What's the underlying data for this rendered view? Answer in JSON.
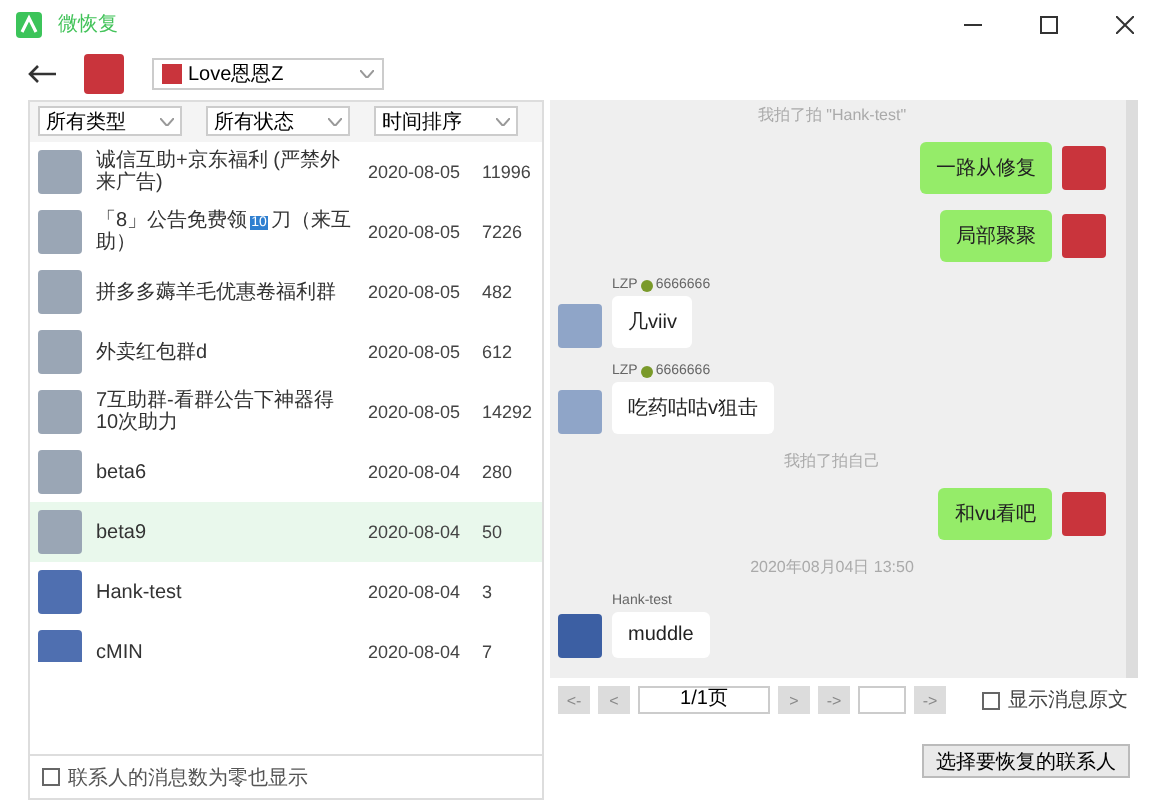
{
  "window": {
    "title": "微恢复"
  },
  "account": {
    "name": "Love恩恩Z"
  },
  "filters": [
    {
      "value": "所有类型"
    },
    {
      "value": "所有状态"
    },
    {
      "value": "时间排序"
    }
  ],
  "contacts": [
    {
      "title": "诚信互助+京东福利 (严禁外来广告)",
      "date": "2020-08-05",
      "count": "11996",
      "selected": false,
      "group": true
    },
    {
      "title": "「8」公告免费领",
      "badge": "10",
      "title_end": "刀（来互助）",
      "date": "2020-08-05",
      "count": "7226",
      "selected": false,
      "group": true
    },
    {
      "title": "拼多多薅羊毛优惠卷福利群",
      "date": "2020-08-05",
      "count": "482",
      "selected": false,
      "group": true
    },
    {
      "title": "外卖红包群d",
      "date": "2020-08-05",
      "count": "612",
      "selected": false,
      "group": true
    },
    {
      "title": "7互助群-看群公告下神器得10次助力",
      "date": "2020-08-05",
      "count": "14292",
      "selected": false,
      "group": true
    },
    {
      "title": "beta6",
      "date": "2020-08-04",
      "count": "280",
      "selected": false,
      "group": true
    },
    {
      "title": "beta9",
      "date": "2020-08-04",
      "count": "50",
      "selected": true,
      "group": true
    },
    {
      "title": "Hank-test",
      "date": "2020-08-04",
      "count": "3",
      "selected": false,
      "group": false
    },
    {
      "title": "cMIN",
      "date": "2020-08-04",
      "count": "7",
      "selected": false,
      "group": false
    }
  ],
  "show_zero": {
    "label": "联系人的消息数为零也显示",
    "checked": false
  },
  "messages": [
    {
      "kind": "system",
      "text": "我拍了拍 \"Hank-test\""
    },
    {
      "kind": "sent",
      "text": "一路从修复"
    },
    {
      "kind": "sent",
      "text": "局部聚聚"
    },
    {
      "kind": "received",
      "name": "LZP",
      "name_end": "6666666",
      "text": "几viiv"
    },
    {
      "kind": "received",
      "name": "LZP",
      "name_end": "6666666",
      "text": "吃药咕咕v狙击"
    },
    {
      "kind": "system",
      "text": "我拍了拍自己"
    },
    {
      "kind": "sent",
      "text": "和vu看吧"
    },
    {
      "kind": "system",
      "text": "2020年08月04日 13:50"
    },
    {
      "kind": "received",
      "name": "Hank-test",
      "text": "muddle"
    }
  ],
  "pager": {
    "first": "<-",
    "prev": "<",
    "page": "1/1页",
    "next": ">",
    "last": "->",
    "go": "->"
  },
  "show_source": {
    "label": "显示消息原文",
    "checked": false
  },
  "restore_button": "选择要恢复的联系人"
}
